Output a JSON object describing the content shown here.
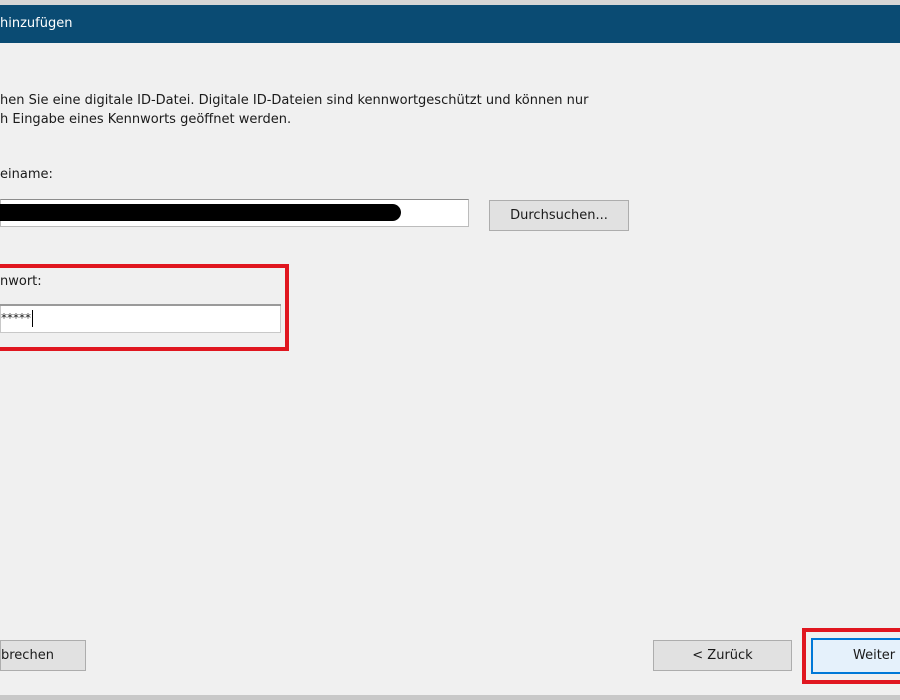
{
  "window": {
    "title": "hinzufügen"
  },
  "description": {
    "line1": "hen Sie eine digitale ID-Datei. Digitale ID-Dateien sind kennwortgeschützt und können nur",
    "line2": "h Eingabe eines Kennworts geöffnet werden."
  },
  "filename": {
    "label": "einame:",
    "value": "",
    "browse_label": "Durchsuchen..."
  },
  "password": {
    "label": "nwort:",
    "value": "*****"
  },
  "footer": {
    "cancel_label": "brechen",
    "back_label": "< Zurück",
    "next_label": "Weiter"
  },
  "colors": {
    "titlebar": "#0a4b73",
    "highlight": "#e0161f",
    "focus_border": "#0078d7"
  }
}
